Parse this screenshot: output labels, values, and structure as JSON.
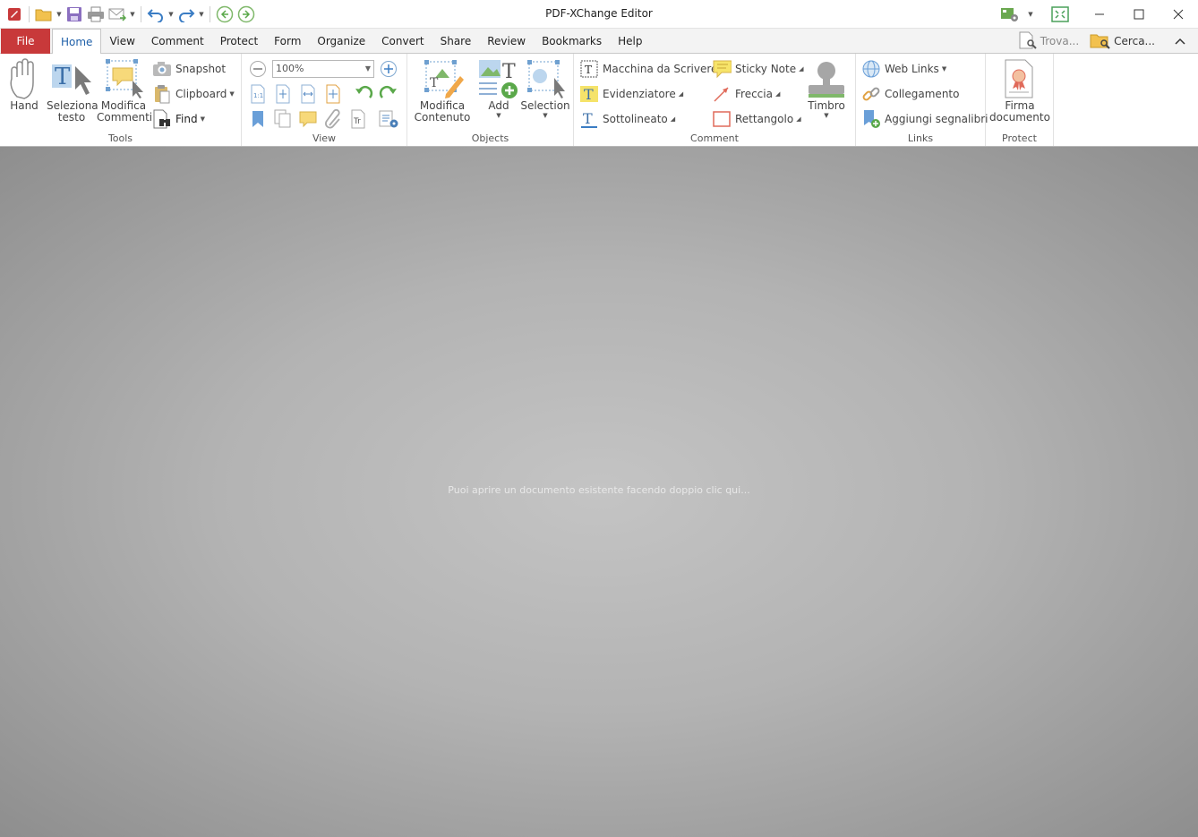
{
  "window": {
    "title": "PDF-XChange Editor"
  },
  "quick_access": {
    "icons": [
      "app-logo-icon",
      "open-folder-icon",
      "save-icon",
      "print-icon",
      "email-icon",
      "undo-icon",
      "redo-icon",
      "back-icon",
      "forward-icon"
    ]
  },
  "title_right": {
    "icons": [
      "customize-ui-icon",
      "fullscreen-icon"
    ]
  },
  "menu": {
    "file_label": "File",
    "tabs": [
      "Home",
      "View",
      "Comment",
      "Protect",
      "Form",
      "Organize",
      "Convert",
      "Share",
      "Review",
      "Bookmarks",
      "Help"
    ],
    "active_tab": "Home"
  },
  "search": {
    "find_label": "Trova...",
    "search_label": "Cerca..."
  },
  "ribbon": {
    "tools": {
      "label": "Tools",
      "hand": "Hand",
      "select_text": "Seleziona testo",
      "edit_comments": "Modifica Commenti",
      "snapshot": "Snapshot",
      "clipboard": "Clipboard",
      "find": "Find"
    },
    "view": {
      "label": "View",
      "zoom_value": "100%"
    },
    "objects": {
      "label": "Objects",
      "edit_content": "Modifica Contenuto",
      "add": "Add",
      "selection": "Selection"
    },
    "comment": {
      "label": "Comment",
      "typewriter": "Macchina da Scrivere",
      "highlight": "Evidenziatore",
      "underline": "Sottolineato",
      "sticky_note": "Sticky Note",
      "arrow": "Freccia",
      "rectangle": "Rettangolo",
      "stamp": "Timbro"
    },
    "links": {
      "label": "Links",
      "web_links": "Web Links",
      "link": "Collegamento",
      "add_bookmarks": "Aggiungi segnalibri"
    },
    "protect": {
      "label": "Protect",
      "sign": "Firma documento"
    }
  },
  "workspace": {
    "hint": "Puoi aprire un documento esistente facendo doppio clic qui..."
  },
  "colors": {
    "file_tab": "#c8393a",
    "active_tab_text": "#1e5fa8"
  }
}
